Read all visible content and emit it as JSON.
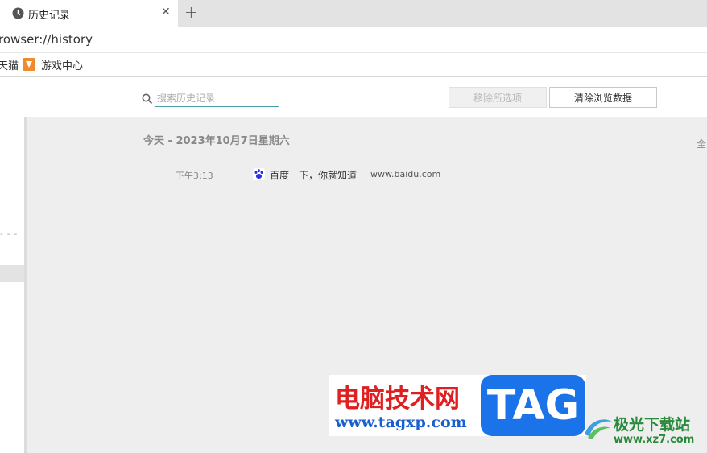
{
  "tab": {
    "title": "历史记录",
    "close": "✕",
    "new_tab": "+"
  },
  "address": {
    "url": "rowser://history"
  },
  "bookmarks": [
    {
      "label": "天猫"
    },
    {
      "label": "游戏中心"
    }
  ],
  "toolbar": {
    "search_placeholder": "搜索历史记录",
    "remove_label": "移除所选项",
    "clear_label": "清除浏览数据"
  },
  "sidebar": {
    "dots": "- - -"
  },
  "history": {
    "date_header": "今天 - 2023年10月7日星期六",
    "select_all": "全",
    "entries": [
      {
        "time": "下午3:13",
        "title": "百度一下，你就知道",
        "url": "www.baidu.com"
      }
    ]
  },
  "watermark": {
    "brand_cn": "电脑技术网",
    "brand_url": "www.tagxp.com",
    "brand_tag": "TAG",
    "site2_cn": "极光下载站",
    "site2_url": "www.xz7.com"
  },
  "colors": {
    "accent_underline": "#48a0a8",
    "content_bg": "#eeeeee",
    "bookmark_icon": "#f1892d",
    "baidu_blue": "#2932e1"
  }
}
